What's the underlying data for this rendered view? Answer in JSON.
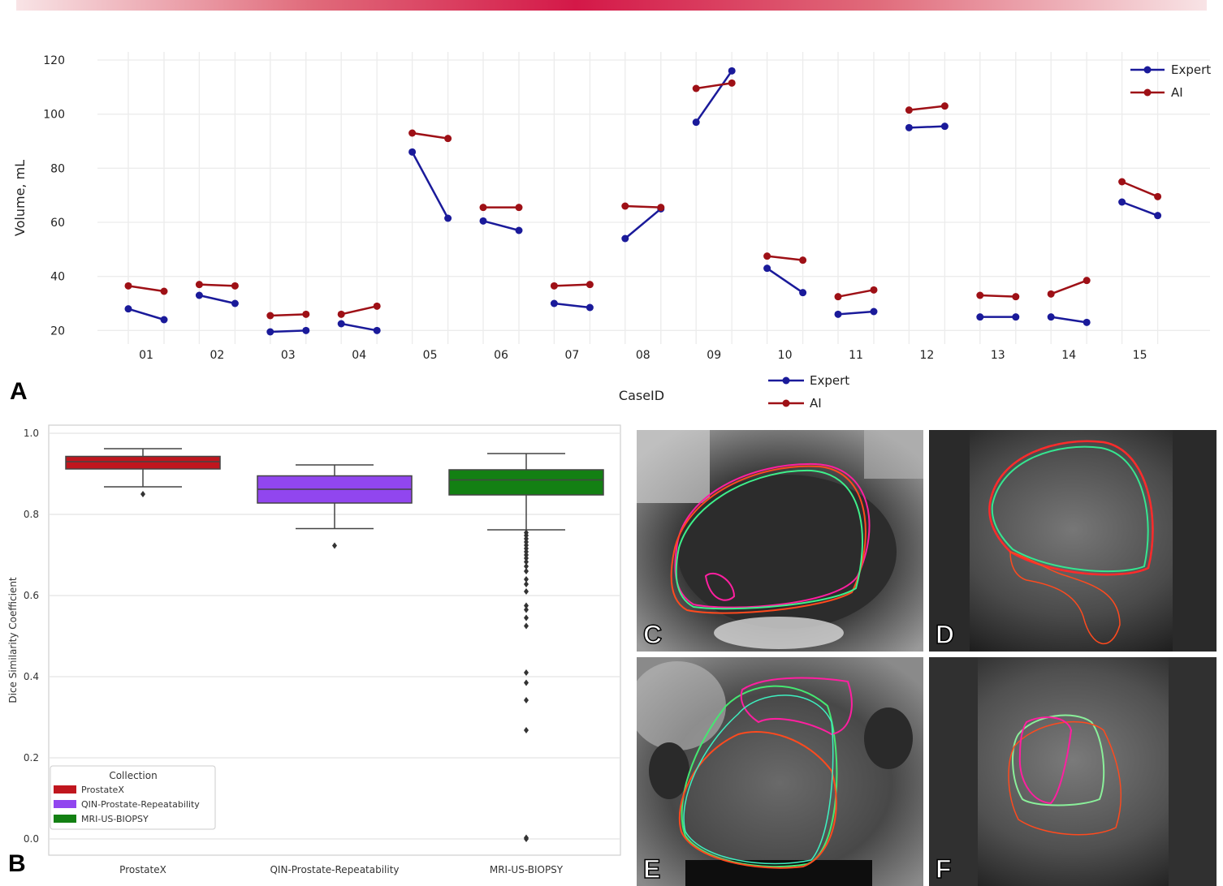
{
  "panels": {
    "a": "A",
    "b": "B",
    "c": "C",
    "d": "D",
    "e": "E",
    "f": "F"
  },
  "colors": {
    "expert": "#1a1a9a",
    "ai": "#9e1016",
    "prostatex": "#c0161e",
    "qin": "#9146ef",
    "mri": "#138013"
  },
  "chart_data": [
    {
      "type": "line",
      "xlabel": "CaseID",
      "ylabel": "Volume, mL",
      "ylim": [
        15,
        123
      ],
      "yticks": [
        20,
        40,
        60,
        80,
        100,
        120
      ],
      "grid": true,
      "legend_position": "top-right",
      "legend_entries": [
        "Expert",
        "AI"
      ],
      "legend_below_entries": [
        "Expert",
        "AI"
      ],
      "categories": [
        "01",
        "02",
        "03",
        "04",
        "05",
        "06",
        "07",
        "08",
        "09",
        "10",
        "11",
        "12",
        "13",
        "14",
        "15"
      ],
      "series": [
        {
          "name": "Expert",
          "values": [
            [
              28,
              24
            ],
            [
              33,
              30
            ],
            [
              19.5,
              20
            ],
            [
              22.5,
              20
            ],
            [
              86,
              61.5
            ],
            [
              60.5,
              57
            ],
            [
              30,
              28.5
            ],
            [
              54,
              65
            ],
            [
              97,
              116
            ],
            [
              43,
              34
            ],
            [
              26,
              27
            ],
            [
              95,
              95.5
            ],
            [
              25,
              25
            ],
            [
              25,
              23
            ],
            [
              67.5,
              62.5
            ]
          ]
        },
        {
          "name": "AI",
          "values": [
            [
              36.5,
              34.5
            ],
            [
              37,
              36.5
            ],
            [
              25.5,
              26
            ],
            [
              26,
              29
            ],
            [
              93,
              91
            ],
            [
              65.5,
              65.5
            ],
            [
              36.5,
              37
            ],
            [
              66,
              65.5
            ],
            [
              109.5,
              111.5
            ],
            [
              47.5,
              46
            ],
            [
              32.5,
              35
            ],
            [
              101.5,
              103
            ],
            [
              33,
              32.5
            ],
            [
              33.5,
              38.5
            ],
            [
              75,
              69.5
            ]
          ]
        }
      ]
    },
    {
      "type": "box",
      "ylabel": "Dice Similarity Coefficient",
      "ylim": [
        -0.04,
        1.02
      ],
      "yticks": [
        "0.0",
        "0.2",
        "0.4",
        "0.6",
        "0.8",
        "1.0"
      ],
      "grid": true,
      "legend_title": "Collection",
      "legend_position": "bottom-left",
      "categories": [
        "ProstateX",
        "QIN-Prostate-Repeatability",
        "MRI-US-BIOPSY"
      ],
      "boxes": [
        {
          "name": "ProstateX",
          "whisker_low": 0.868,
          "q1": 0.912,
          "median": 0.93,
          "q3": 0.943,
          "whisker_high": 0.962,
          "outliers": [
            0.85
          ]
        },
        {
          "name": "QIN-Prostate-Repeatability",
          "whisker_low": 0.765,
          "q1": 0.828,
          "median": 0.862,
          "q3": 0.895,
          "whisker_high": 0.922,
          "outliers": [
            0.723
          ]
        },
        {
          "name": "MRI-US-BIOPSY",
          "whisker_low": 0.762,
          "q1": 0.848,
          "median": 0.885,
          "q3": 0.91,
          "whisker_high": 0.95,
          "outliers": [
            0.755,
            0.748,
            0.74,
            0.732,
            0.724,
            0.716,
            0.708,
            0.7,
            0.692,
            0.683,
            0.672,
            0.66,
            0.64,
            0.628,
            0.61,
            0.575,
            0.565,
            0.545,
            0.525,
            0.41,
            0.385,
            0.342,
            0.268,
            0.003,
            0.0
          ]
        }
      ]
    }
  ]
}
